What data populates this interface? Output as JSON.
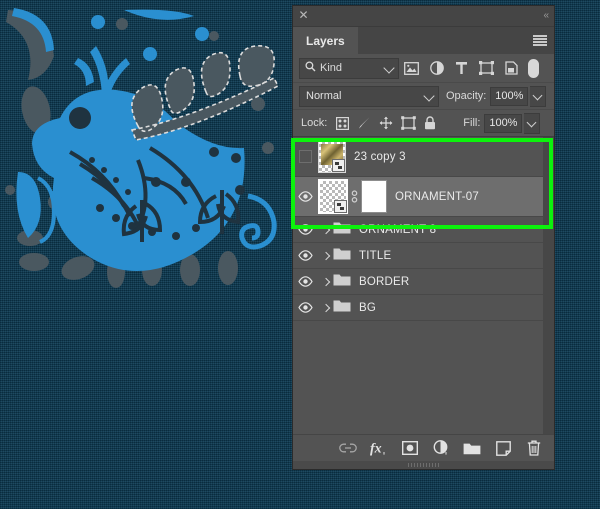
{
  "panel": {
    "close_icon": "close-icon",
    "collapse_icon": "collapse-panel-icon",
    "tab_label": "Layers",
    "menu_icon": "panel-menu-icon"
  },
  "filter_bar": {
    "kind_label": "Kind",
    "search_icon": "search-icon",
    "filters": [
      {
        "name": "filter-pixel-layers",
        "icon": "image-icon"
      },
      {
        "name": "filter-adjustment-layers",
        "icon": "adjustment-circle-icon"
      },
      {
        "name": "filter-type-layers",
        "icon": "type-t-icon"
      },
      {
        "name": "filter-shape-layers",
        "icon": "shape-bounds-icon"
      },
      {
        "name": "filter-smart-objects",
        "icon": "smart-object-icon"
      }
    ],
    "toggle_name": "filter-enable-toggle"
  },
  "blend_bar": {
    "blend_mode": "Normal",
    "opacity_label": "Opacity:",
    "opacity_value": "100%"
  },
  "lock_bar": {
    "lock_label": "Lock:",
    "fill_label": "Fill:",
    "fill_value": "100%",
    "locks": [
      {
        "name": "lock-transparent-pixels-button",
        "icon": "checkerboard-icon"
      },
      {
        "name": "lock-image-pixels-button",
        "icon": "brush-icon"
      },
      {
        "name": "lock-position-button",
        "icon": "move-arrows-icon"
      },
      {
        "name": "lock-artboard-nesting-button",
        "icon": "artboard-icon"
      },
      {
        "name": "lock-all-button",
        "icon": "padlock-icon"
      }
    ]
  },
  "layers": [
    {
      "name": "23 copy 3",
      "visible": false,
      "selected": false,
      "type": "layer",
      "thumb": "image-thumbnail",
      "has_mask": false,
      "linked": false
    },
    {
      "name": "ORNAMENT-07",
      "visible": true,
      "selected": true,
      "type": "layer",
      "thumb": "transparent-thumbnail",
      "has_mask": true,
      "linked": true
    },
    {
      "name": "ORNAMENT 8",
      "visible": true,
      "selected": false,
      "type": "group",
      "thumb": "folder-icon",
      "has_mask": false,
      "linked": false
    },
    {
      "name": "TITLE",
      "visible": true,
      "selected": false,
      "type": "group",
      "thumb": "folder-icon",
      "has_mask": false,
      "linked": false
    },
    {
      "name": "BORDER",
      "visible": true,
      "selected": false,
      "type": "group",
      "thumb": "folder-icon",
      "has_mask": false,
      "linked": false
    },
    {
      "name": "BG",
      "visible": true,
      "selected": false,
      "type": "group",
      "thumb": "folder-icon",
      "has_mask": false,
      "linked": false
    }
  ],
  "bottom_bar": [
    {
      "name": "link-layers-button",
      "icon": "link-icon"
    },
    {
      "name": "layer-style-button",
      "icon": "fx-icon"
    },
    {
      "name": "add-layer-mask-button",
      "icon": "mask-icon"
    },
    {
      "name": "new-fill-adjustment-layer-button",
      "icon": "half-circle-icon"
    },
    {
      "name": "new-group-button",
      "icon": "folder-icon"
    },
    {
      "name": "new-layer-button",
      "icon": "new-layer-icon"
    },
    {
      "name": "delete-layer-button",
      "icon": "trash-icon"
    }
  ],
  "annotation": {
    "highlight_color": "#0cf20c",
    "highlight_name": "green-highlight-box"
  },
  "canvas": {
    "background_color": "#0d3d56",
    "artwork_accent": "#2a8fd0",
    "artwork_dark": "#2b3a42",
    "watermark_lines": [
      "",
      "",
      ""
    ]
  }
}
